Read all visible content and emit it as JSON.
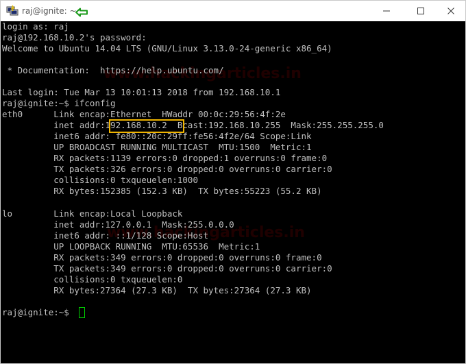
{
  "window": {
    "title": "raj@ignite: ~",
    "controls": {
      "minimize_icon": "minimize-icon",
      "maximize_icon": "maximize-icon",
      "close_icon": "close-icon"
    }
  },
  "annotation": {
    "arrow_color": "#1a9a1a",
    "highlight_color": "#f0b400"
  },
  "watermarks": [
    "www.hackingarticles.in",
    "www.hackingarticles.in"
  ],
  "terminal": {
    "lines": [
      "login as: raj",
      "raj@192.168.10.2's password:",
      "Welcome to Ubuntu 14.04 LTS (GNU/Linux 3.13.0-24-generic x86_64)",
      "",
      " * Documentation:  https://help.ubuntu.com/",
      "",
      "Last login: Tue Mar 13 10:01:13 2018 from 192.168.10.1",
      "raj@ignite:~$ ifconfig",
      "eth0      Link encap:Ethernet  HWaddr 00:0c:29:56:4f:2e",
      "          inet addr:192.168.10.2  Bcast:192.168.10.255  Mask:255.255.255.0",
      "          inet6 addr: fe80::20c:29ff:fe56:4f2e/64 Scope:Link",
      "          UP BROADCAST RUNNING MULTICAST  MTU:1500  Metric:1",
      "          RX packets:1139 errors:0 dropped:1 overruns:0 frame:0",
      "          TX packets:326 errors:0 dropped:0 overruns:0 carrier:0",
      "          collisions:0 txqueuelen:1000",
      "          RX bytes:152385 (152.3 KB)  TX bytes:55223 (55.2 KB)",
      "",
      "lo        Link encap:Local Loopback",
      "          inet addr:127.0.0.1  Mask:255.0.0.0",
      "          inet6 addr: ::1/128 Scope:Host",
      "          UP LOOPBACK RUNNING  MTU:65536  Metric:1",
      "          RX packets:349 errors:0 dropped:0 overruns:0 frame:0",
      "          TX packets:349 errors:0 dropped:0 overruns:0 carrier:0",
      "          collisions:0 txqueuelen:0",
      "          RX bytes:27364 (27.3 KB)  TX bytes:27364 (27.3 KB)",
      "",
      "raj@ignite:~$ "
    ]
  }
}
